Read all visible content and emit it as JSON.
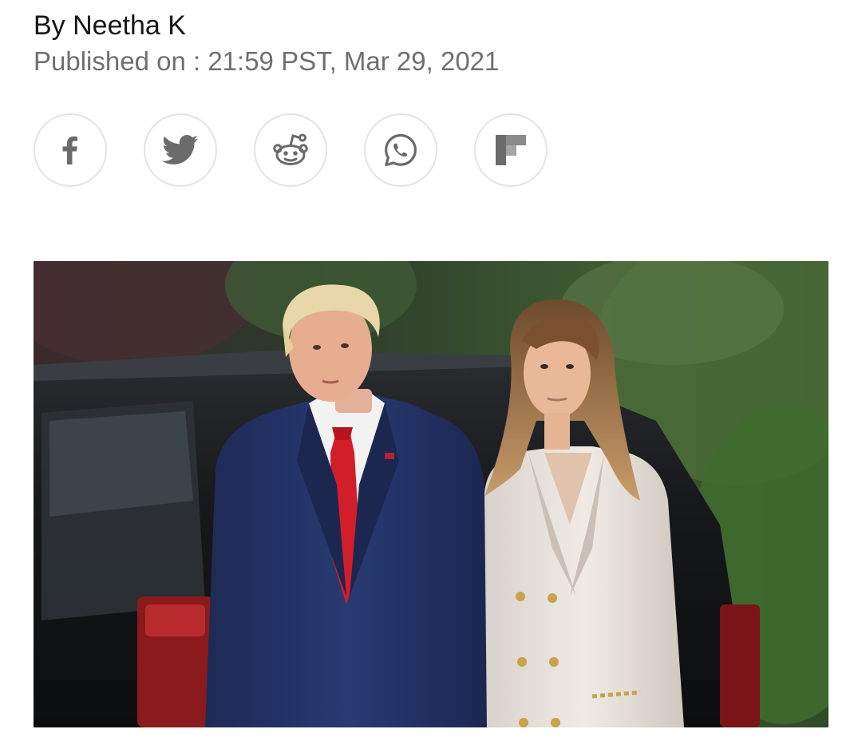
{
  "article": {
    "byline": "By Neetha K",
    "published": "Published on : 21:59 PST, Mar 29, 2021"
  },
  "share": {
    "buttons": [
      {
        "name": "facebook",
        "icon": "facebook-icon"
      },
      {
        "name": "twitter",
        "icon": "twitter-icon"
      },
      {
        "name": "reddit",
        "icon": "reddit-icon"
      },
      {
        "name": "whatsapp",
        "icon": "whatsapp-icon"
      },
      {
        "name": "flipboard",
        "icon": "flipboard-icon"
      }
    ],
    "icon_color": "#6b6b6b",
    "border_color": "#e3e3e3"
  },
  "hero_image": {
    "subject": "photo of a man in a navy suit with a red tie and a woman in a white double-breasted coat standing in front of a black SUV"
  }
}
